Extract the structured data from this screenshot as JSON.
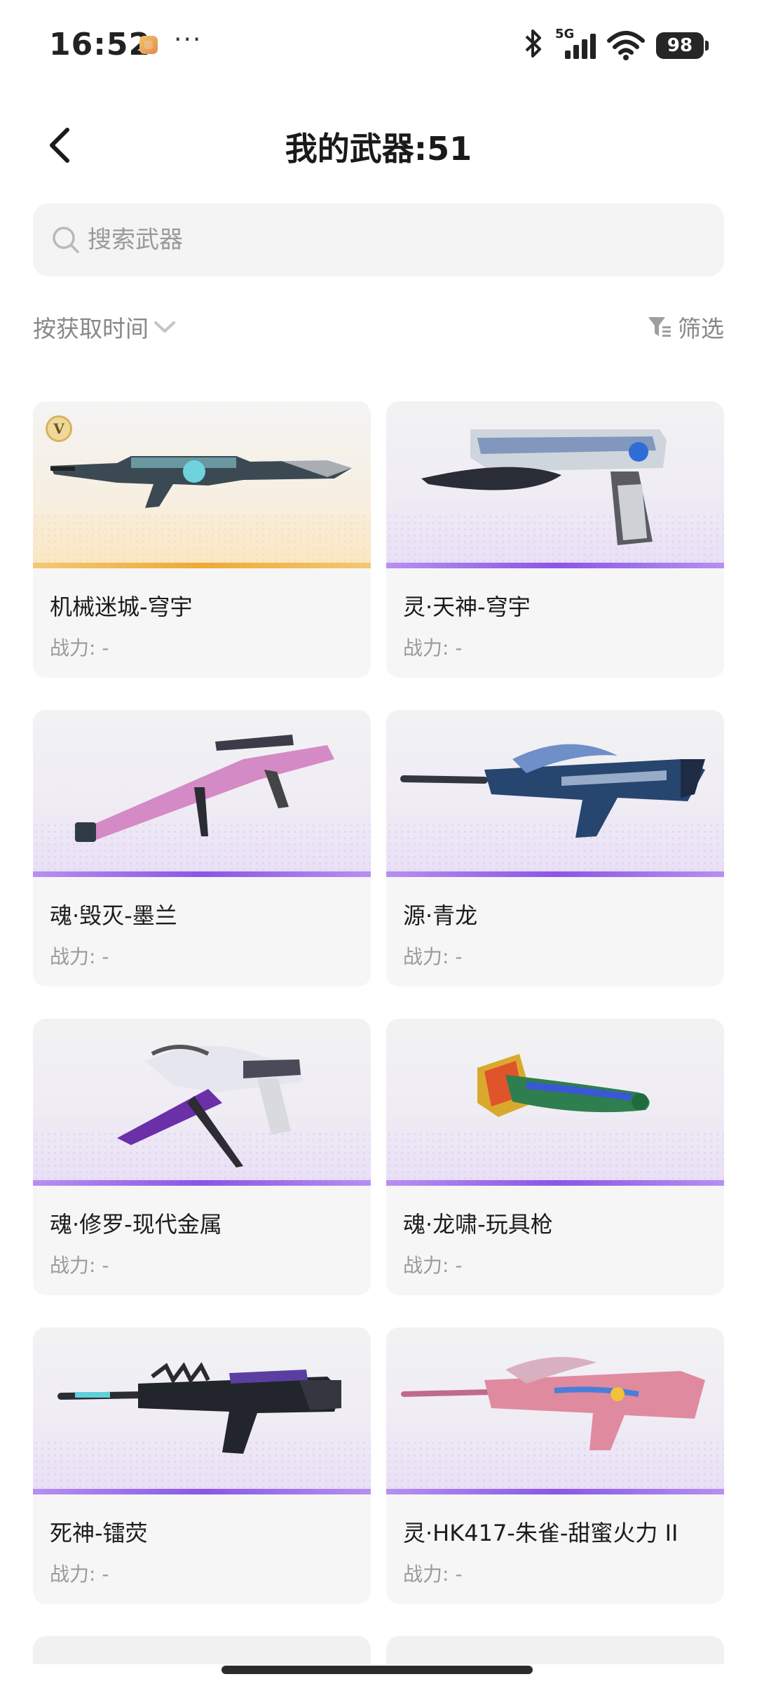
{
  "status_bar": {
    "time": "16:52",
    "more": "···",
    "network": "5G",
    "battery": "98"
  },
  "header": {
    "title": "我的武器:51"
  },
  "search": {
    "placeholder": "搜索武器"
  },
  "toolbar": {
    "sort_label": "按获取时间",
    "filter_label": "筛选"
  },
  "weapons": [
    {
      "name": "机械迷城-穹宇",
      "power": "战力: -",
      "rarity": "gold",
      "badge": "V"
    },
    {
      "name": "灵·天神-穹宇",
      "power": "战力: -",
      "rarity": "purple"
    },
    {
      "name": "魂·毁灭-墨兰",
      "power": "战力: -",
      "rarity": "purple"
    },
    {
      "name": "源·青龙",
      "power": "战力: -",
      "rarity": "purple"
    },
    {
      "name": "魂·修罗-现代金属",
      "power": "战力: -",
      "rarity": "purple"
    },
    {
      "name": "魂·龙啸-玩具枪",
      "power": "战力: -",
      "rarity": "purple"
    },
    {
      "name": "死神-镭荧",
      "power": "战力: -",
      "rarity": "purple"
    },
    {
      "name": "灵·HK417-朱雀-甜蜜火力 II",
      "power": "战力: -",
      "rarity": "purple"
    }
  ],
  "colors": {
    "gold_strip": "#eeaa33",
    "purple_strip": "#8b55e6",
    "card_bg": "#f6f6f7"
  }
}
